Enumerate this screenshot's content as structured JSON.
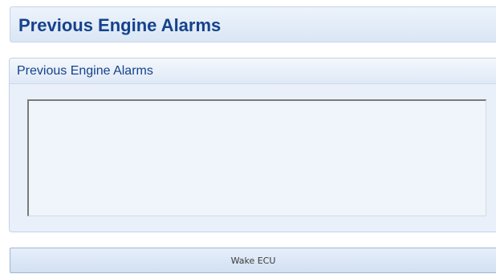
{
  "header": {
    "title": "Previous Engine Alarms"
  },
  "group": {
    "title": "Previous Engine Alarms",
    "alarms": []
  },
  "actions": {
    "wake_label": "Wake ECU"
  },
  "colors": {
    "title_text": "#15428b",
    "panel_background": "#e9f0fa",
    "button_border": "#9fb6d4"
  }
}
